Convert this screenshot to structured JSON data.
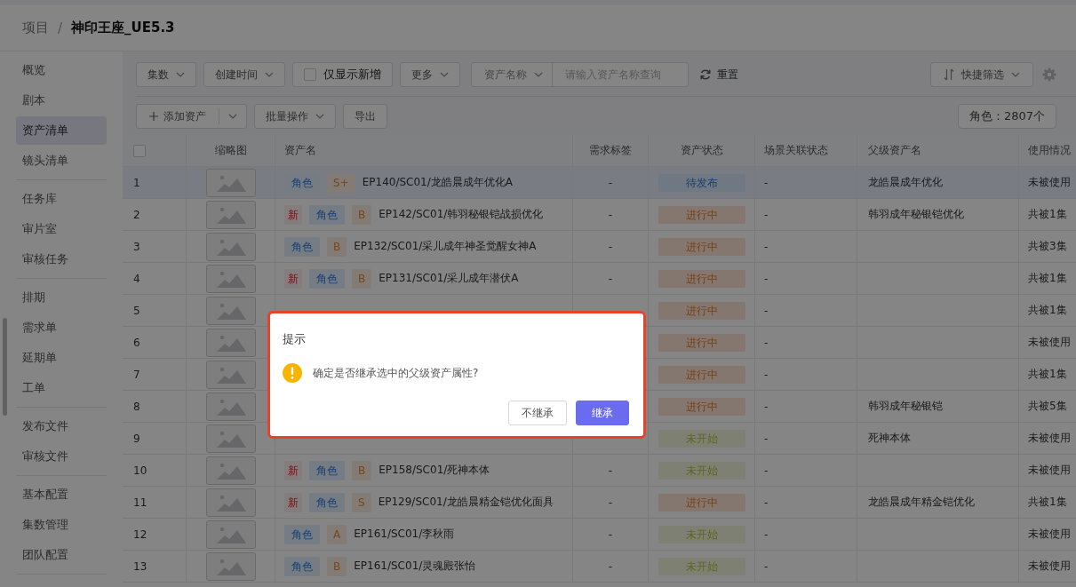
{
  "breadcrumb": {
    "parent": "项目",
    "separator": "/",
    "current": "神印王座_UE5.3"
  },
  "sidebar": {
    "groups": [
      {
        "items": [
          {
            "label": "概览",
            "selected": false
          },
          {
            "label": "剧本",
            "selected": false
          },
          {
            "label": "资产清单",
            "selected": true
          },
          {
            "label": "镜头清单",
            "selected": false
          }
        ]
      },
      {
        "items": [
          {
            "label": "任务库",
            "selected": false
          },
          {
            "label": "审片室",
            "selected": false
          },
          {
            "label": "审核任务",
            "selected": false
          }
        ]
      },
      {
        "items": [
          {
            "label": "排期",
            "selected": false
          },
          {
            "label": "需求单",
            "selected": false
          },
          {
            "label": "延期单",
            "selected": false
          },
          {
            "label": "工单",
            "selected": false
          }
        ]
      },
      {
        "items": [
          {
            "label": "发布文件",
            "selected": false
          },
          {
            "label": "审核文件",
            "selected": false
          }
        ]
      },
      {
        "items": [
          {
            "label": "基本配置",
            "selected": false
          },
          {
            "label": "集数管理",
            "selected": false
          },
          {
            "label": "团队配置",
            "selected": false
          }
        ]
      }
    ]
  },
  "filters": [
    {
      "kind": "dropdown",
      "label": "集数"
    },
    {
      "kind": "dropdown",
      "label": "创建时间"
    },
    {
      "kind": "checkbox",
      "label": "仅显示新增",
      "checked": false
    },
    {
      "kind": "dropdown",
      "label": "更多"
    }
  ],
  "search": {
    "field_label": "资产名称",
    "placeholder": "请输入资产名称查询"
  },
  "reset": "重置",
  "quick_filter": "快捷筛选",
  "actions": {
    "add": "添加资产",
    "batch": "批量操作",
    "export": "导出",
    "count": "角色：2807个"
  },
  "table": {
    "select_all_checked": false,
    "columns": [
      "缩略图",
      "资产名",
      "需求标签",
      "资产状态",
      "场景关联状态",
      "父级资产名",
      "使用情况"
    ],
    "rows": [
      {
        "index": "1",
        "selected": true,
        "type": "角色",
        "grade": "S+",
        "name": "EP140/SC01/龙皓晨成年优化A",
        "tag": "-",
        "status": {
          "text": "待发布",
          "kind": "pending"
        },
        "scene": "-",
        "parent": "龙皓晨成年优化",
        "usage": "未被使用"
      },
      {
        "index": "2",
        "selected": false,
        "new_tag": "新",
        "type": "角色",
        "grade": "B",
        "name": "EP142/SC01/韩羽秘银铠战损优化",
        "tag": "-",
        "status": {
          "text": "进行中",
          "kind": "progress"
        },
        "scene": "-",
        "parent": "韩羽成年秘银铠优化",
        "usage": "共被1集"
      },
      {
        "index": "3",
        "selected": false,
        "type": "角色",
        "grade": "B",
        "name": "EP132/SC01/采儿成年神圣觉醒女神A",
        "tag": "-",
        "status": {
          "text": "进行中",
          "kind": "progress"
        },
        "scene": "-",
        "usage": "共被3集"
      },
      {
        "index": "4",
        "selected": false,
        "new_tag": "新",
        "type": "角色",
        "grade": "B",
        "name": "EP131/SC01/采儿成年潜伏A",
        "tag": "-",
        "status": {
          "text": "进行中",
          "kind": "progress"
        },
        "scene": "-",
        "usage": "共被1集"
      },
      {
        "index": "5",
        "selected": false,
        "status": {
          "text": "进行中",
          "kind": "progress"
        },
        "scene": "-",
        "usage": "共被1集"
      },
      {
        "index": "6",
        "selected": false,
        "status": {
          "text": "进行中",
          "kind": "progress"
        },
        "scene": "-",
        "usage": "未被使用"
      },
      {
        "index": "7",
        "selected": false,
        "status": {
          "text": "进行中",
          "kind": "progress"
        },
        "scene": "-",
        "usage": "共被1集"
      },
      {
        "index": "8",
        "selected": false,
        "status": {
          "text": "进行中",
          "kind": "progress"
        },
        "scene": "-",
        "parent": "韩羽成年秘银铠",
        "usage": "共被5集"
      },
      {
        "index": "9",
        "selected": false,
        "status": {
          "text": "未开始",
          "kind": "todo"
        },
        "scene": "-",
        "parent": "死神本体",
        "usage": "未被使用"
      },
      {
        "index": "10",
        "selected": false,
        "new_tag": "新",
        "type": "角色",
        "grade": "B",
        "name": "EP158/SC01/死神本体",
        "tag": "-",
        "status": {
          "text": "未开始",
          "kind": "todo"
        },
        "scene": "-",
        "usage": "未被使用"
      },
      {
        "index": "11",
        "selected": false,
        "new_tag": "新",
        "type": "角色",
        "grade": "S",
        "name": "EP129/SC01/龙皓晨精金铠优化面具",
        "tag": "-",
        "status": {
          "text": "进行中",
          "kind": "progress"
        },
        "scene": "-",
        "parent": "龙皓晨成年精金铠优化",
        "usage": "共被1集"
      },
      {
        "index": "12",
        "selected": false,
        "type": "角色",
        "grade": "A",
        "name": "EP161/SC01/李秋雨",
        "tag": "-",
        "status": {
          "text": "未开始",
          "kind": "todo"
        },
        "scene": "-",
        "usage": "未被使用"
      },
      {
        "index": "13",
        "selected": false,
        "type": "角色",
        "grade": "B",
        "name": "EP161/SC01/灵魂殿张怡",
        "tag": "-",
        "status": {
          "text": "未开始",
          "kind": "todo"
        },
        "scene": "-",
        "usage": "未被使用"
      }
    ]
  },
  "dialog": {
    "title": "提示",
    "message": "确定是否继承选中的父级资产属性?",
    "cancel": "不继承",
    "confirm": "继承"
  }
}
